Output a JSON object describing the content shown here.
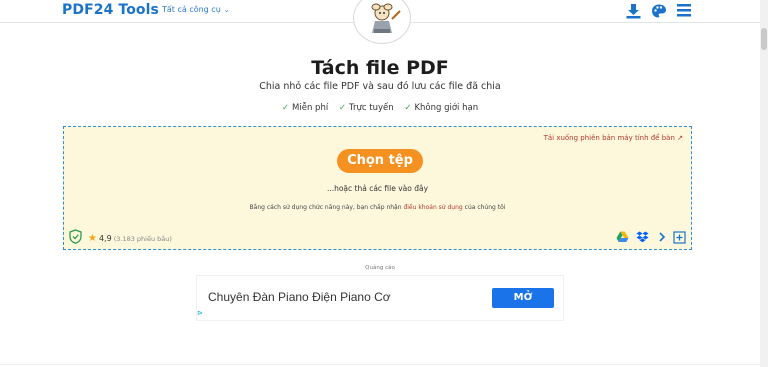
{
  "header": {
    "logo": "PDF24 Tools",
    "tools_menu": "Tất cả công cụ"
  },
  "icons": {
    "download": "download-icon",
    "theme": "palette-icon",
    "menu": "hamburger-menu-icon",
    "mascot": "mascot-logo-icon"
  },
  "hero": {
    "title": "Tách file PDF",
    "subtitle": "Chia nhỏ các file PDF và sau đó lưu các file đã chia",
    "features": [
      "Miễn phí",
      "Trực tuyến",
      "Không giới hạn"
    ]
  },
  "dropzone": {
    "desktop_link": "Tải xuống phiên bản máy tính để bàn",
    "choose_button": "Chọn tệp",
    "drop_hint": "...hoặc thả các file vào đây",
    "terms_prefix": "Bằng cách sử dụng chức năng này, bạn chấp nhận ",
    "terms_link": "điều khoản sử dụng",
    "terms_suffix": " của chúng tôi",
    "rating": "4,9",
    "rating_count": "(3.183 phiếu bầu)"
  },
  "ad": {
    "label": "Quảng cáo",
    "text": "Chuyên Đàn Piano Điện Piano Cơ",
    "button": "MỞ"
  },
  "colors": {
    "brand_blue": "#1a73c8",
    "accent_orange": "#f59120",
    "dropzone_bg": "#fdf8dc",
    "link_red": "#b43a2e"
  }
}
